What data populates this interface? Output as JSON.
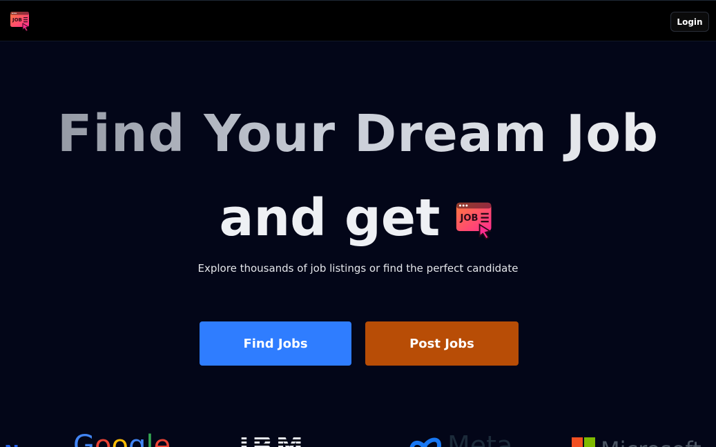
{
  "header": {
    "logo_text": "JOB",
    "login_label": "Login"
  },
  "hero": {
    "headline_line1": "Find Your Dream Job",
    "headline_line2": "and get",
    "subtitle": "Explore thousands of job listings or find the perfect candidate",
    "find_jobs_label": "Find Jobs",
    "post_jobs_label": "Post Jobs"
  },
  "logos": {
    "partial": "AN",
    "google": [
      "G",
      "o",
      "o",
      "g",
      "l",
      "e"
    ],
    "ibm": "IBM",
    "meta": "Meta",
    "microsoft": "Microsoft"
  },
  "colors": {
    "background": "#030618",
    "topbar": "#000000",
    "find_jobs": "#2f7dff",
    "post_jobs": "#b84d06",
    "logo_gradient_start": "#ff7a3d",
    "logo_gradient_end": "#ff2d8f"
  },
  "icons": [
    "job-logo-icon"
  ]
}
